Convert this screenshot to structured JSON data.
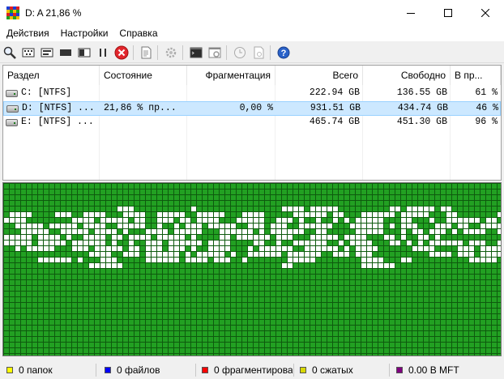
{
  "window": {
    "title": "D:  A  21,86 %",
    "app_icon": "defrag-grid-icon"
  },
  "menu": {
    "items": [
      "Действия",
      "Настройки",
      "Справка"
    ]
  },
  "toolbar": {
    "buttons": [
      "analyze-icon",
      "defrag-icon",
      "quick-optimize-icon",
      "full-optimize-icon",
      "mft-optimize-icon",
      "pause-icon",
      "stop-icon",
      "report-icon",
      "settings-icon",
      "console-icon",
      "boot-time-icon",
      "schedule-icon",
      "scripts-icon",
      "help-icon"
    ]
  },
  "list": {
    "columns": [
      "Раздел",
      "Состояние",
      "Фрагментация",
      "Всего",
      "Свободно",
      "В пр..."
    ],
    "rows": [
      {
        "volume": "C: [NTFS]",
        "status": "",
        "fragmentation": "",
        "total": "222.94 GB",
        "free": "136.55 GB",
        "percent": "61 %",
        "selected": false
      },
      {
        "volume": "D: [NTFS] ...",
        "status": "21,86 % пр...",
        "fragmentation": "0,00 %",
        "total": "931.51 GB",
        "free": "434.74 GB",
        "percent": "46 %",
        "selected": true
      },
      {
        "volume": "E: [NTFS] ...",
        "status": "",
        "fragmentation": "",
        "total": "465.74 GB",
        "free": "451.30 GB",
        "percent": "96 %",
        "selected": false
      }
    ]
  },
  "cluster_map": {
    "colors": {
      "used": "#22a022",
      "free": "#ffffff",
      "grid": "#0e5a0e"
    }
  },
  "statusbar": {
    "items": [
      {
        "label": "0 папок",
        "color": "#ffff00"
      },
      {
        "label": "0 файлов",
        "color": "#0000ff"
      },
      {
        "label": "0 фрагментирова",
        "color": "#ff0000"
      },
      {
        "label": "0 сжатых",
        "color": "#d8d800"
      },
      {
        "label": "0.00 В MFT",
        "color": "#800080"
      }
    ]
  }
}
